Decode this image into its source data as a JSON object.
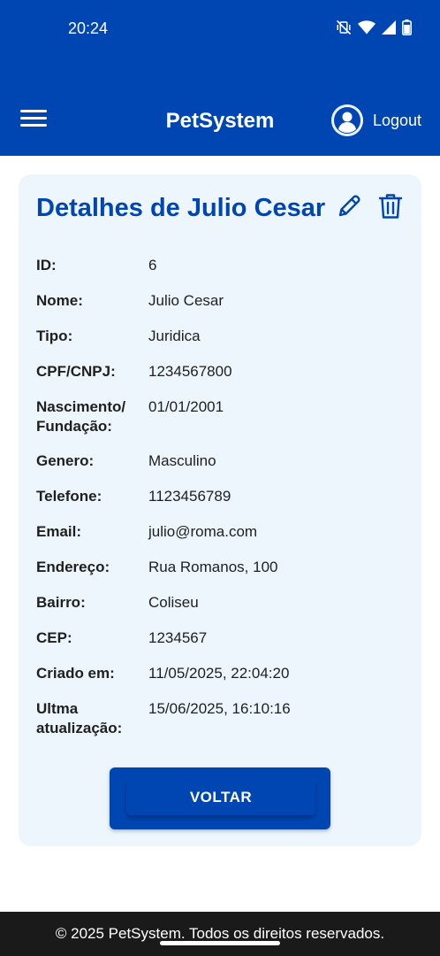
{
  "status_bar": {
    "time": "20:24",
    "icons": [
      "vibrate-off-icon",
      "wifi-icon",
      "signal-icon",
      "battery-icon"
    ]
  },
  "app_bar": {
    "title": "PetSystem",
    "logout_label": "Logout"
  },
  "card": {
    "title": "Detalhes de Julio Cesar",
    "fields": [
      {
        "label": "ID:",
        "value": "6"
      },
      {
        "label": "Nome:",
        "value": "Julio Cesar"
      },
      {
        "label": "Tipo:",
        "value": "Juridica"
      },
      {
        "label": "CPF/CNPJ:",
        "value": "1234567800"
      },
      {
        "label": "Nascimento/ Fundação:",
        "value": "01/01/2001"
      },
      {
        "label": "Genero:",
        "value": "Masculino"
      },
      {
        "label": "Telefone:",
        "value": "1123456789"
      },
      {
        "label": "Email:",
        "value": "julio@roma.com"
      },
      {
        "label": "Endereço:",
        "value": "Rua Romanos, 100"
      },
      {
        "label": "Bairro:",
        "value": "Coliseu"
      },
      {
        "label": "CEP:",
        "value": "1234567"
      },
      {
        "label": "Criado em:",
        "value": "11/05/2025, 22:04:20"
      },
      {
        "label": "Ultma atualização:",
        "value": "15/06/2025, 16:10:16"
      }
    ],
    "back_label": "VOLTAR"
  },
  "footer": {
    "text": "© 2025 PetSystem. Todos os direitos reservados."
  },
  "colors": {
    "primary": "#0046b3",
    "card_bg": "#edf5fd",
    "footer_bg": "#1a1a1a"
  }
}
